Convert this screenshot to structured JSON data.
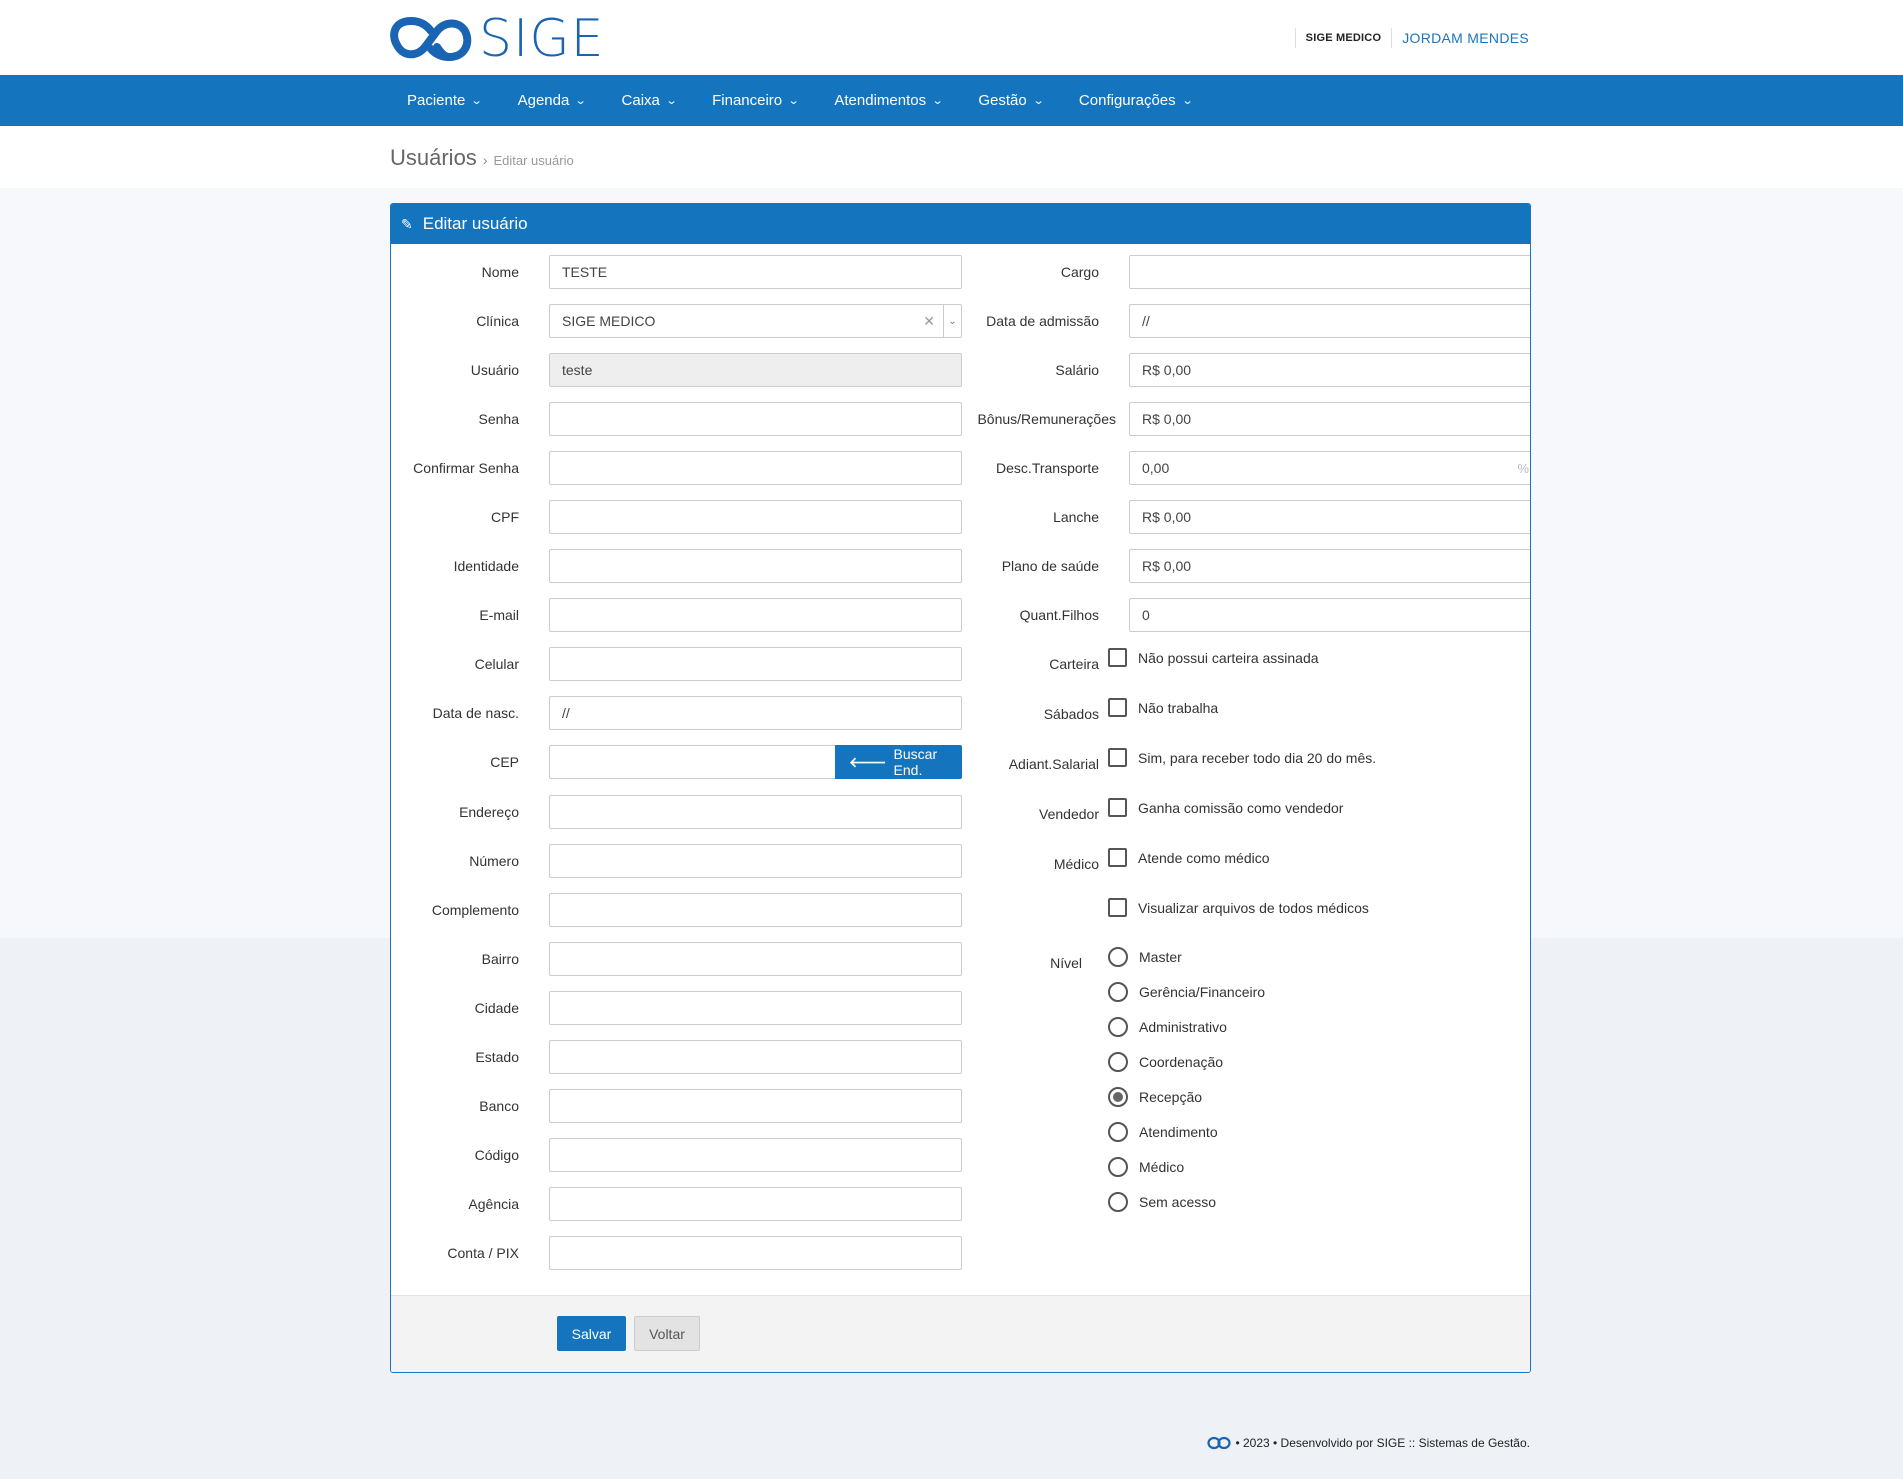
{
  "header": {
    "brand": "SIGE",
    "clinic": "SIGE MEDICO",
    "user": "JORDAM MENDES"
  },
  "nav": [
    {
      "label": "Paciente"
    },
    {
      "label": "Agenda"
    },
    {
      "label": "Caixa"
    },
    {
      "label": "Financeiro"
    },
    {
      "label": "Atendimentos"
    },
    {
      "label": "Gestão"
    },
    {
      "label": "Configurações"
    }
  ],
  "breadcrumb": {
    "title": "Usuários",
    "separator": "›",
    "current": "Editar usuário"
  },
  "panel": {
    "title": "Editar usuário"
  },
  "left_fields": {
    "nome": {
      "label": "Nome",
      "value": "TESTE"
    },
    "clinica": {
      "label": "Clínica",
      "value": "SIGE MEDICO"
    },
    "usuario": {
      "label": "Usuário",
      "value": "teste"
    },
    "senha": {
      "label": "Senha",
      "value": ""
    },
    "confirmar": {
      "label": "Confirmar Senha",
      "value": ""
    },
    "cpf": {
      "label": "CPF",
      "value": ""
    },
    "identidade": {
      "label": "Identidade",
      "value": ""
    },
    "email": {
      "label": "E-mail",
      "value": ""
    },
    "celular": {
      "label": "Celular",
      "value": ""
    },
    "nasc": {
      "label": "Data de nasc.",
      "value": "//"
    },
    "cep": {
      "label": "CEP",
      "value": "",
      "button": "Buscar End."
    },
    "endereco": {
      "label": "Endereço",
      "value": ""
    },
    "numero": {
      "label": "Número",
      "value": ""
    },
    "complemento": {
      "label": "Complemento",
      "value": ""
    },
    "bairro": {
      "label": "Bairro",
      "value": ""
    },
    "cidade": {
      "label": "Cidade",
      "value": ""
    },
    "estado": {
      "label": "Estado",
      "value": ""
    },
    "banco": {
      "label": "Banco",
      "value": ""
    },
    "codigo": {
      "label": "Código",
      "value": ""
    },
    "agencia": {
      "label": "Agência",
      "value": ""
    },
    "conta": {
      "label": "Conta / PIX",
      "value": ""
    }
  },
  "right_fields": {
    "cargo": {
      "label": "Cargo",
      "value": ""
    },
    "admissao": {
      "label": "Data de admissão",
      "value": "//"
    },
    "salario": {
      "label": "Salário",
      "value": "R$ 0,00"
    },
    "bonus": {
      "label": "Bônus/Remunerações",
      "value": "R$ 0,00"
    },
    "transporte": {
      "label": "Desc.Transporte",
      "value": "0,00",
      "suffix": "%"
    },
    "lanche": {
      "label": "Lanche",
      "value": "R$ 0,00"
    },
    "plano": {
      "label": "Plano de saúde",
      "value": "R$ 0,00"
    },
    "filhos": {
      "label": "Quant.Filhos",
      "value": "0"
    }
  },
  "checkboxes": {
    "carteira": {
      "label": "Carteira",
      "text": "Não possui carteira assinada",
      "checked": false
    },
    "sabados": {
      "label": "Sábados",
      "text": "Não trabalha",
      "checked": false
    },
    "adiant": {
      "label": "Adiant.Salarial",
      "text": "Sim, para receber todo dia 20 do mês.",
      "checked": false
    },
    "vendedor": {
      "label": "Vendedor",
      "text": "Ganha comissão como vendedor",
      "checked": false
    },
    "medico": {
      "label": "Médico",
      "text": "Atende como médico",
      "checked": false
    },
    "arquivos": {
      "label": "",
      "text": "Visualizar arquivos de todos médicos",
      "checked": false
    }
  },
  "nivel": {
    "label": "Nível",
    "options": [
      "Master",
      "Gerência/Financeiro",
      "Administrativo",
      "Coordenação",
      "Recepção",
      "Atendimento",
      "Médico",
      "Sem acesso"
    ],
    "selected": "Recepção"
  },
  "actions": {
    "save": "Salvar",
    "back": "Voltar"
  },
  "footer": {
    "text": "• 2023 • Desenvolvido por SIGE :: Sistemas de Gestão."
  }
}
